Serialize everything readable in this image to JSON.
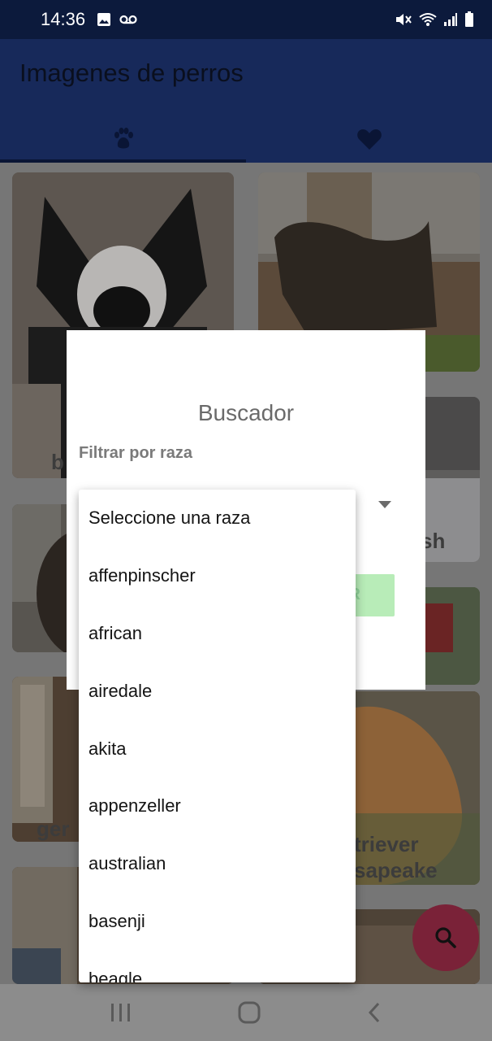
{
  "status_bar": {
    "time": "14:36",
    "icons": [
      "image-icon",
      "voicemail-icon",
      "mute-icon",
      "wifi-icon",
      "signal-icon",
      "battery-icon"
    ]
  },
  "app_bar": {
    "title": "Imagenes de perros",
    "tabs": [
      {
        "icon": "paw-icon",
        "selected": true
      },
      {
        "icon": "heart-icon",
        "selected": false
      }
    ]
  },
  "cards": [
    {
      "label": "b"
    },
    {
      "label": ""
    },
    {
      "label": "sh"
    },
    {
      "label": ""
    },
    {
      "label": "ger"
    },
    {
      "label": "triever"
    },
    {
      "label": "sapeake"
    }
  ],
  "dialog": {
    "title": "Buscador",
    "filter_label": "Filtrar por raza",
    "button_label": "R"
  },
  "dropdown": {
    "options": [
      "Seleccione una raza",
      "affenpinscher",
      "african",
      "airedale",
      "akita",
      "appenzeller",
      "australian",
      "basenji",
      "beagle"
    ]
  },
  "fab": {
    "icon": "search-icon"
  },
  "nav_bar": {
    "icons": [
      "recent-apps-icon",
      "home-icon",
      "back-icon"
    ]
  },
  "colors": {
    "status_bar": "#0c1a3c",
    "app_bar": "#17295a",
    "fab": "#7a2238",
    "button": "#b8ecb8",
    "dialog": "#ffffff"
  }
}
